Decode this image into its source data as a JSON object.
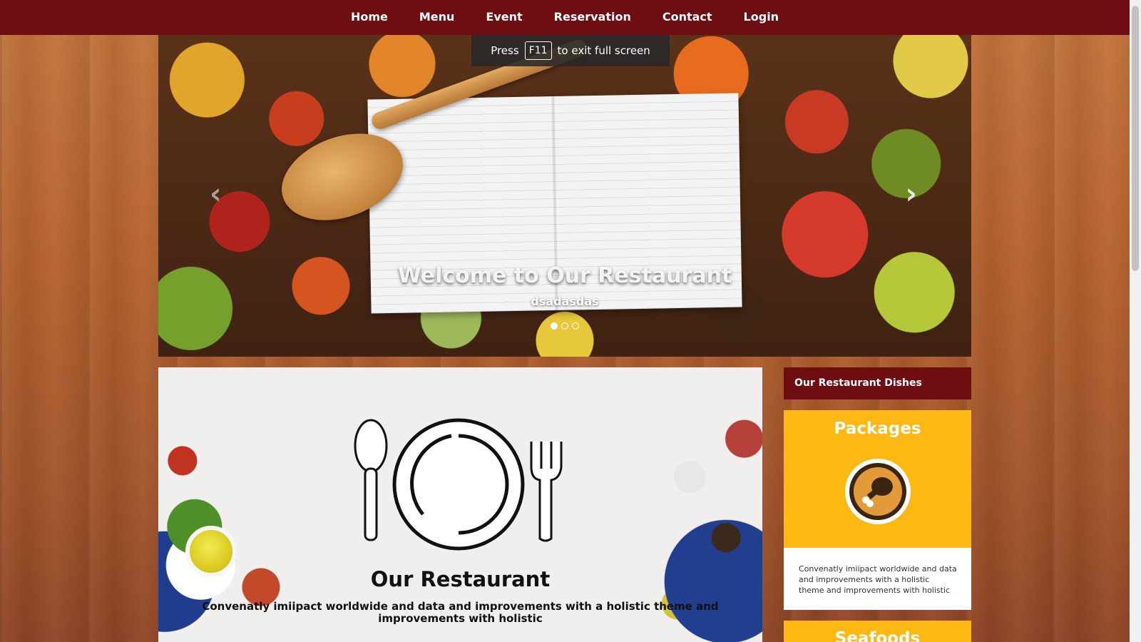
{
  "nav": {
    "items": [
      {
        "label": "Home"
      },
      {
        "label": "Menu"
      },
      {
        "label": "Event"
      },
      {
        "label": "Reservation"
      },
      {
        "label": "Contact"
      },
      {
        "label": "Login"
      }
    ]
  },
  "fullscreen_notice": {
    "prefix": "Press",
    "key": "F11",
    "suffix": "to exit full screen"
  },
  "hero": {
    "title": "Welcome to Our Restaurant",
    "subtitle": "dsadasdas",
    "prev_icon": "chevron-left-icon",
    "next_icon": "chevron-right-icon",
    "prev_glyph": "‹",
    "next_glyph": "›",
    "slides": 3,
    "active_slide": 1
  },
  "main": {
    "title": "Our Restaurant",
    "description": "Convenatly imiipact worldwide and data and improvements with a holistic theme and improvements with holistic",
    "icon": "plate-fork-spoon-icon"
  },
  "sidebar": {
    "header": "Our Restaurant Dishes",
    "cards": [
      {
        "title": "Packages",
        "icon": "chicken-leg-icon",
        "text": "Convenatly imiipact worldwide and data and improvements with a holistic theme and improvements with holistic"
      },
      {
        "title": "Seafoods"
      }
    ]
  },
  "colors": {
    "nav_bg": "#6e0d12",
    "accent_yellow": "#fdb813",
    "nav_text": "#ffffff"
  }
}
